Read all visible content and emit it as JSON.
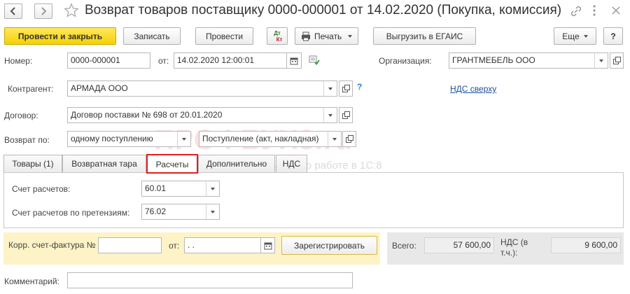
{
  "window": {
    "title": "Возврат товаров поставщику 0000-000001 от 14.02.2020 (Покупка, комиссия)"
  },
  "toolbar": {
    "post_close": "Провести и закрыть",
    "save": "Записать",
    "post": "Провести",
    "dtkt": "Дт\nКт",
    "print": "Печать",
    "egais": "Выгрузить в ЕГАИС",
    "more": "Еще",
    "help": "?"
  },
  "header": {
    "number_label": "Номер:",
    "number_value": "0000-000001",
    "date_label": "от:",
    "date_value": "14.02.2020 12:00:01",
    "org_label": "Организация:",
    "org_value": "ГРАНТМЕБЕЛЬ ООО",
    "counterparty_label": "Контрагент:",
    "counterparty_value": "АРМАДА ООО",
    "vat_link": "НДС сверху",
    "contract_label": "Договор:",
    "contract_value": "Договор поставки № 698 от 20.01.2020",
    "return_label": "Возврат по:",
    "return_value": "одному поступлению",
    "receipt_value": "Поступление (акт, накладная)"
  },
  "watermark": {
    "main": "ПРОФБУХ8.ru",
    "sub": "Онлайн курсы по работе в 1С:8"
  },
  "tabs": [
    {
      "label": "Товары (1)"
    },
    {
      "label": "Возвратная тара"
    },
    {
      "label": "Расчеты"
    },
    {
      "label": "Дополнительно"
    },
    {
      "label": "НДС"
    }
  ],
  "settlements": {
    "account_label": "Счет расчетов:",
    "account_value": "60.01",
    "claims_label": "Счет расчетов по претензиям:",
    "claims_value": "76.02"
  },
  "invoice": {
    "label": "Корр. счет-фактура №",
    "number_value": "",
    "date_label": "от:",
    "date_value": " .  .",
    "register_button": "Зарегистрировать"
  },
  "totals": {
    "total_label": "Всего:",
    "total_value": "57 600,00",
    "vat_label": "НДС (в т.ч.):",
    "vat_value": "9 600,00"
  },
  "comment": {
    "label": "Комментарий:",
    "value": ""
  },
  "colors": {
    "primary_button": "#f5d200",
    "tab_highlight": "#e02020",
    "link": "#1a4f9c",
    "invoice_zone": "#fdf3c6"
  }
}
